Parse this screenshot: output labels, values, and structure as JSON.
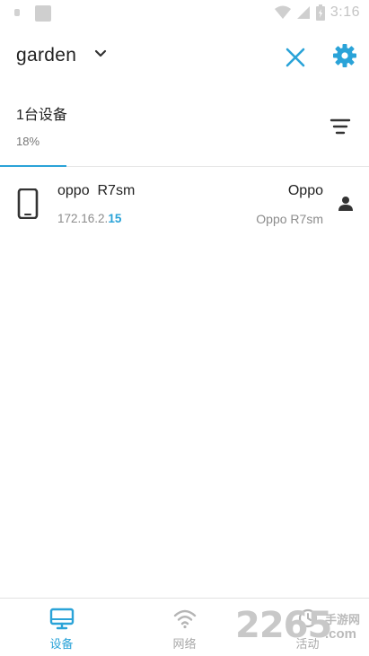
{
  "status_bar": {
    "time": "3:16"
  },
  "header": {
    "network_name": "garden"
  },
  "summary": {
    "device_count_label": "1台设备",
    "progress_label": "18%",
    "progress": 0.18
  },
  "devices": [
    {
      "name": "oppo  R7sm",
      "ip_prefix": "172.16.2.",
      "ip_suffix": "15",
      "brand": "Oppo",
      "model": "Oppo R7sm"
    }
  ],
  "bottom_nav": {
    "tabs": [
      {
        "label": "设备",
        "icon": "monitor-icon",
        "active": true
      },
      {
        "label": "网络",
        "icon": "wifi-icon",
        "active": false
      },
      {
        "label": "活动",
        "icon": "activity-icon",
        "active": false
      }
    ]
  },
  "watermark": {
    "number": "2265",
    "site_cn": "手游网",
    "site_domain": ".com"
  },
  "colors": {
    "accent": "#2aa3d8",
    "text": "#222222",
    "muted": "#8c8c8c",
    "divider": "#e6e6e6"
  }
}
